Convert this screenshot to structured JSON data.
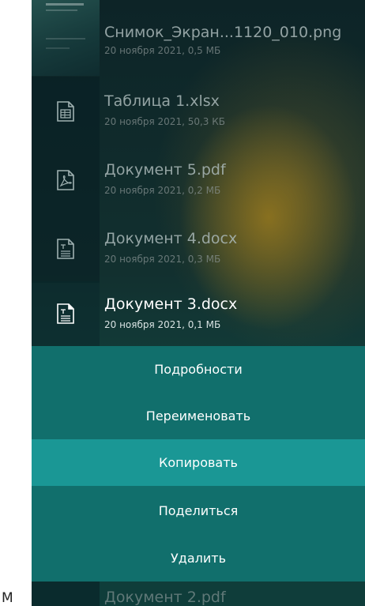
{
  "edge_letter": "M",
  "files": [
    {
      "name": "Снимок_Экран...1120_010.png",
      "meta": "20 ноября 2021, 0,5 МБ",
      "icon": "image-thumbnail"
    },
    {
      "name": "Таблица 1.xlsx",
      "meta": "20 ноября 2021, 50,3 КБ",
      "icon": "spreadsheet-icon"
    },
    {
      "name": "Документ 5.pdf",
      "meta": "20 ноября 2021, 0,2 МБ",
      "icon": "pdf-icon"
    },
    {
      "name": "Документ 4.docx",
      "meta": "20 ноября 2021, 0,3 МБ",
      "icon": "text-document-icon"
    },
    {
      "name": "Документ 3.docx",
      "meta": "20 ноября 2021, 0,1 МБ",
      "icon": "text-document-icon"
    }
  ],
  "context_menu": {
    "items": [
      "Подробности",
      "Переименовать",
      "Копировать",
      "Поделиться",
      "Удалить"
    ],
    "active_item": "Копировать"
  },
  "peek_file": {
    "name": "Документ 2.pdf"
  },
  "colors": {
    "menu_background": "#116f6c",
    "menu_active": "#1a9795",
    "background": "#0f2f30"
  }
}
